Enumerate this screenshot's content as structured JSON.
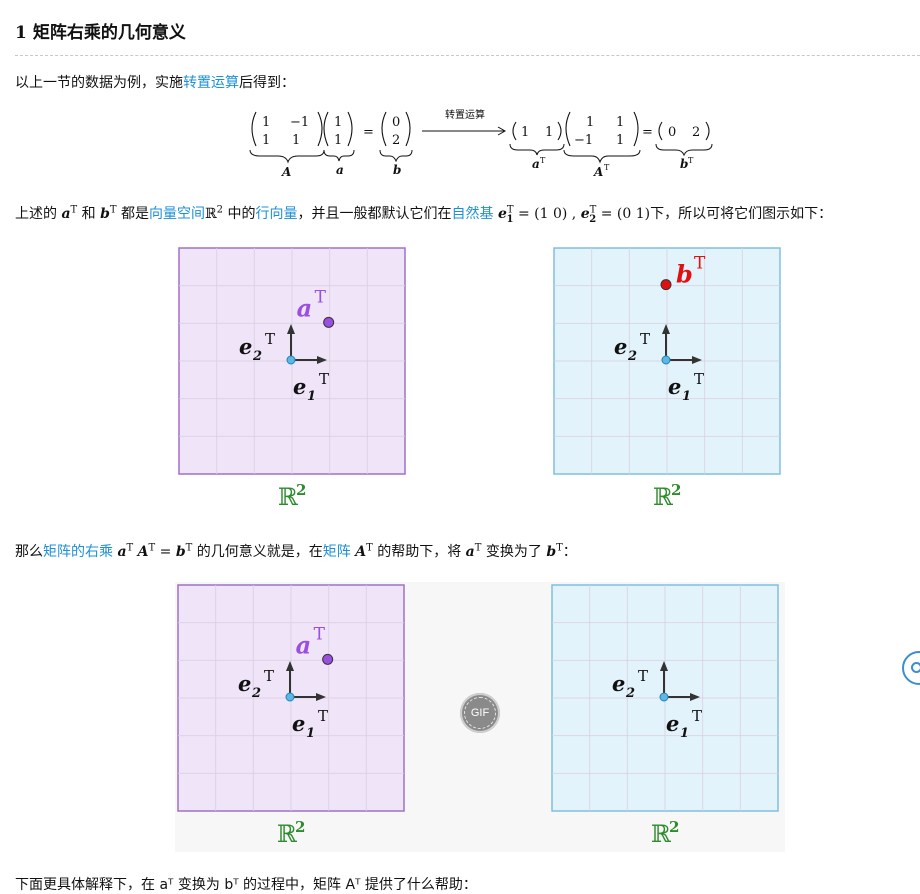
{
  "section": {
    "number": "1",
    "title": "矩阵右乘的几何意义"
  },
  "para1": {
    "before": "以上一节的数据为例，实施",
    "link": "转置运算",
    "after": "后得到："
  },
  "equation": {
    "arrow_label": "转置运算",
    "matrix_A": [
      "1",
      "−1",
      "1",
      "1"
    ],
    "vector_a": [
      "1",
      "1"
    ],
    "vector_b": [
      "0",
      "2"
    ],
    "row_aT": [
      "1",
      "1"
    ],
    "matrix_AT": [
      "1",
      "1",
      "−1",
      "1"
    ],
    "row_bT": [
      "0",
      "2"
    ],
    "brace_labels": [
      "A",
      "a",
      "b",
      "a",
      "A",
      "b"
    ],
    "sup": "T"
  },
  "para2": {
    "t1": "上述的",
    "a": "a",
    "t2": "和",
    "b": "b",
    "t3": "都是",
    "link1": "向量空间",
    "R": "ℝ",
    "R_sup": "2",
    "t4": "中的",
    "link2": "行向量",
    "t5": "，并且一般都默认它们在",
    "link3": "自然基",
    "e1": "e",
    "e1_sub": "1",
    "e1_val": "= (1   0) ,",
    "e2": "e",
    "e2_sub": "2",
    "e2_val": "= (0   1)",
    "t6": "下，所以可将它们图示如下：",
    "sup": "T"
  },
  "para3": {
    "t1": "那么",
    "link1": "矩阵的右乘",
    "a": "a",
    "A": "A",
    "eq": "=",
    "b": "b",
    "t2": "的几何意义就是，在",
    "link2": "矩阵",
    "A2": "A",
    "t3": "的帮助下，将",
    "a2": "a",
    "t4": "变换为了",
    "b2": "b",
    "t5": "：",
    "sup": "T"
  },
  "figures": {
    "space_label": "ℝ",
    "space_sup": "2",
    "e1": "e",
    "e1_sub": "1",
    "e2": "e",
    "e2_sub": "2",
    "a_label": "a",
    "b_label": "b",
    "sup": "T",
    "purple_fill": "#efe4f8",
    "purple_border": "#a070c8",
    "blue_fill": "#e3f3fb",
    "blue_border": "#80c0e0",
    "a_color": "#9b4fe0",
    "b_color": "#e01010",
    "green": "#2e8b2e"
  },
  "gif_label": "GIF",
  "bottom_text": "下面更具体解释下，在 aᵀ 变换为 bᵀ 的过程中，矩阵 Aᵀ 提供了什么帮助："
}
